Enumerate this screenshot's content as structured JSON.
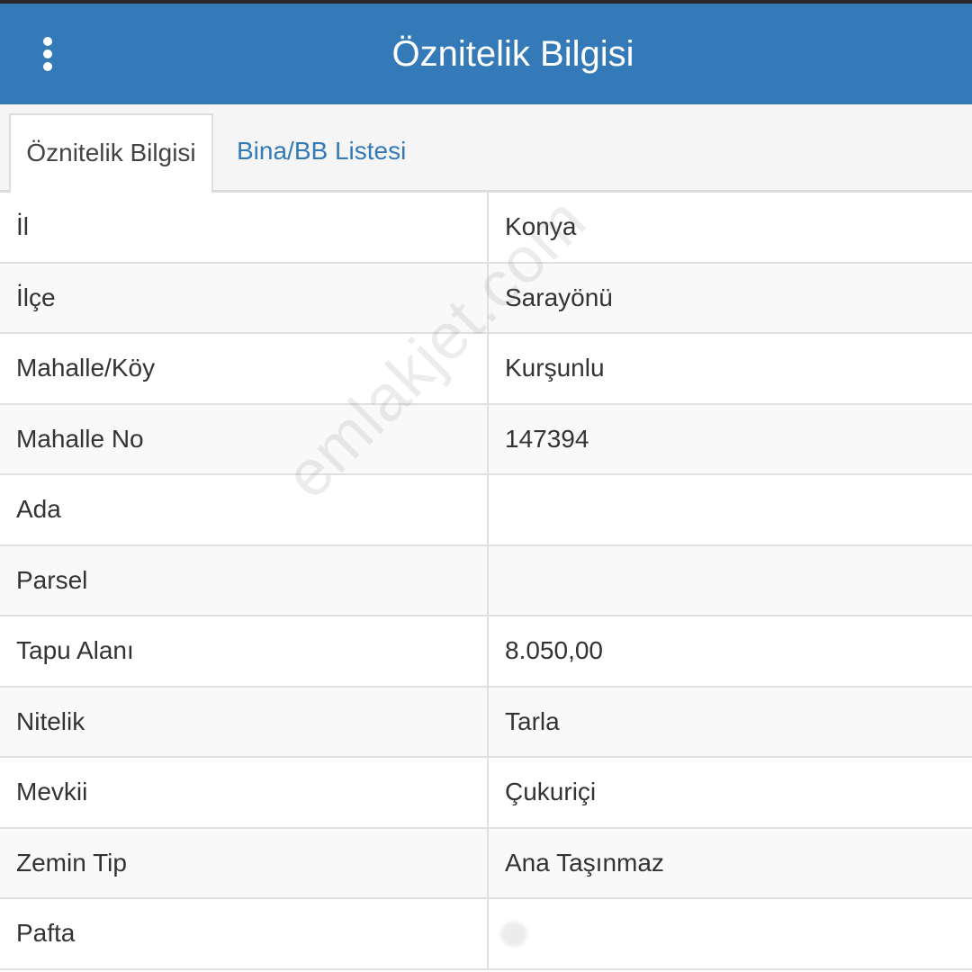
{
  "header": {
    "title": "Öznitelik Bilgisi",
    "menu_icon": "kebab-menu-icon"
  },
  "tabs": [
    {
      "label": "Öznitelik Bilgisi",
      "active": true
    },
    {
      "label": "Bina/BB Listesi",
      "active": false
    }
  ],
  "rows": [
    {
      "label": "İl",
      "value": "Konya"
    },
    {
      "label": "İlçe",
      "value": "Sarayönü"
    },
    {
      "label": "Mahalle/Köy",
      "value": "Kurşunlu"
    },
    {
      "label": "Mahalle No",
      "value": "147394"
    },
    {
      "label": "Ada",
      "value": ""
    },
    {
      "label": "Parsel",
      "value": ""
    },
    {
      "label": "Tapu Alanı",
      "value": "8.050,00"
    },
    {
      "label": "Nitelik",
      "value": "Tarla"
    },
    {
      "label": "Mevkii",
      "value": "Çukuriçi"
    },
    {
      "label": "Zemin Tip",
      "value": "Ana Taşınmaz"
    },
    {
      "label": "Pafta",
      "value": ""
    }
  ],
  "watermark": "emlakjet.com",
  "colors": {
    "header_bg": "#347ab8",
    "tab_link": "#337ab7",
    "border": "#e0e0e0"
  }
}
